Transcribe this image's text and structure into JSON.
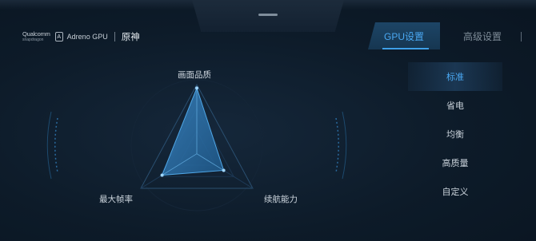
{
  "brand": {
    "qualcomm": "Qualcomm",
    "snapdragon": "snapdragon",
    "adreno_icon_glyph": "A",
    "adreno": "Adreno GPU",
    "game": "原神"
  },
  "tabs": [
    {
      "label": "GPU设置",
      "active": true
    },
    {
      "label": "高级设置",
      "active": false
    }
  ],
  "menu": [
    {
      "label": "标准",
      "active": true
    },
    {
      "label": "省电",
      "active": false
    },
    {
      "label": "均衡",
      "active": false
    },
    {
      "label": "高质量",
      "active": false
    },
    {
      "label": "自定义",
      "active": false
    }
  ],
  "radar": {
    "axes": [
      "画面品质",
      "最大帧率",
      "续航能力"
    ],
    "values": [
      0.95,
      0.62,
      0.48
    ]
  },
  "colors": {
    "accent": "#4aa8f2",
    "background": "#0d1b29"
  }
}
